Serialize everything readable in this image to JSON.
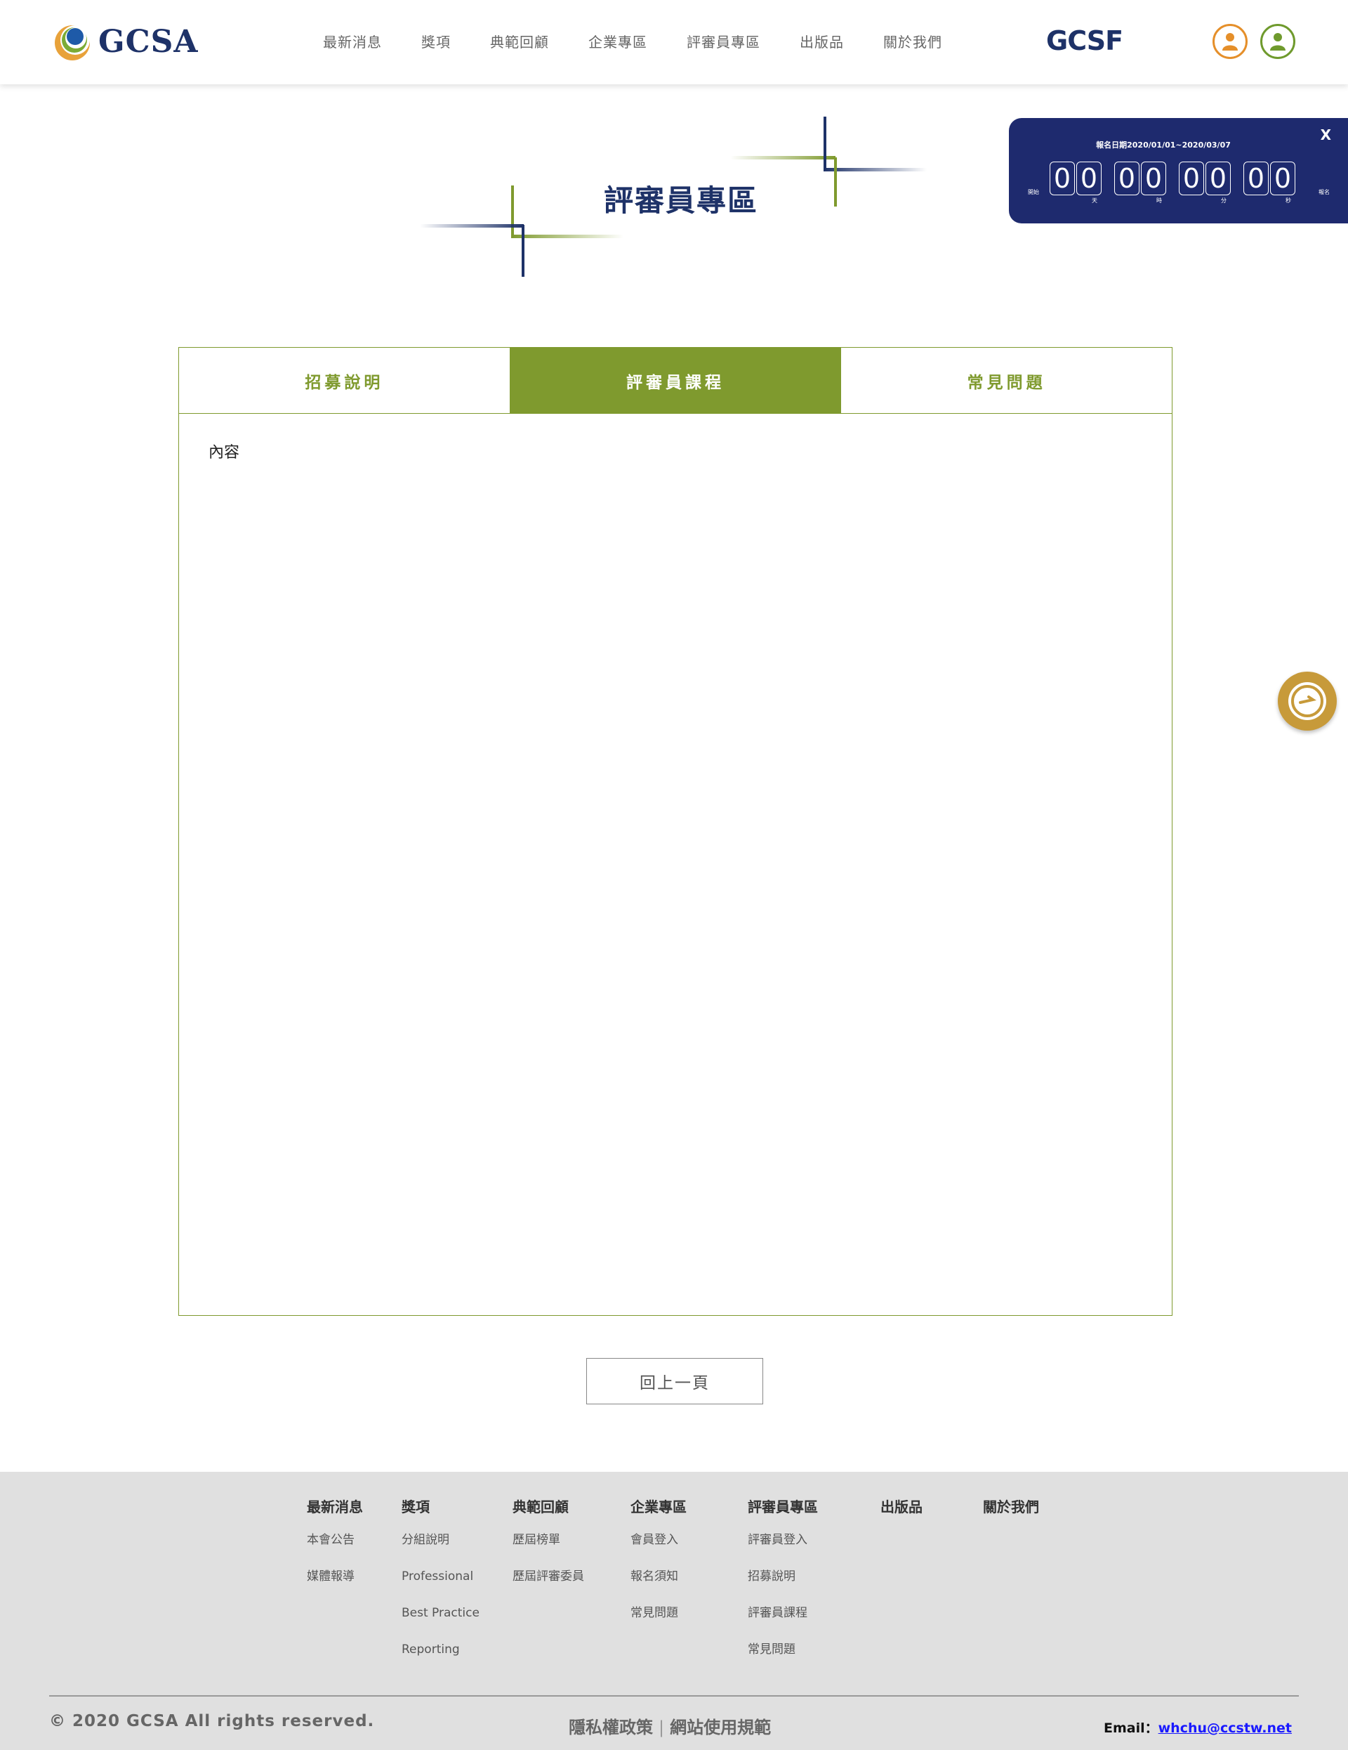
{
  "header": {
    "logo_text": "GCSA",
    "nav": [
      "最新消息",
      "獎項",
      "典範回顧",
      "企業專區",
      "評審員專區",
      "出版品",
      "關於我們"
    ],
    "gcsf_text": "GCSF",
    "colors": {
      "brand_navy": "#1e3268",
      "orange": "#e58f2a",
      "green": "#6f9a2d"
    }
  },
  "countdown": {
    "title": "報名日期2020/01/01~2020/03/07",
    "close_label": "X",
    "start_label": "開始",
    "end_label": "報名",
    "groups": [
      {
        "digits": [
          "0",
          "0"
        ],
        "unit": "天"
      },
      {
        "digits": [
          "0",
          "0"
        ],
        "unit": "時"
      },
      {
        "digits": [
          "0",
          "0"
        ],
        "unit": "分"
      },
      {
        "digits": [
          "0",
          "0"
        ],
        "unit": "秒"
      }
    ]
  },
  "page": {
    "title": "評審員專區",
    "tabs": [
      {
        "label": "招募說明",
        "active": false
      },
      {
        "label": "評審員課程",
        "active": true
      },
      {
        "label": "常見問題",
        "active": false
      }
    ],
    "content": "內容",
    "back_button": "回上一頁",
    "accent_color": "#7f9a2e"
  },
  "footer": {
    "columns": [
      {
        "head": "最新消息",
        "items": [
          "本會公告",
          "媒體報導"
        ]
      },
      {
        "head": "獎項",
        "items": [
          "分組說明",
          "Professional",
          "Best Practice",
          "Reporting"
        ]
      },
      {
        "head": "典範回顧",
        "items": [
          "歷屆榜單",
          "歷屆評審委員"
        ]
      },
      {
        "head": "企業專區",
        "items": [
          "會員登入",
          "報名須知",
          "常見問題"
        ]
      },
      {
        "head": "評審員專區",
        "items": [
          "評審員登入",
          "招募說明",
          "評審員課程",
          "常見問題"
        ]
      },
      {
        "head": "出版品",
        "items": []
      },
      {
        "head": "關於我們",
        "items": []
      }
    ],
    "copyright": "© 2020 GCSA All rights reserved.",
    "privacy": "隱私權政策",
    "terms": "網站使用規範",
    "email_label": "Email：",
    "email": "whchu@ccstw.net"
  }
}
